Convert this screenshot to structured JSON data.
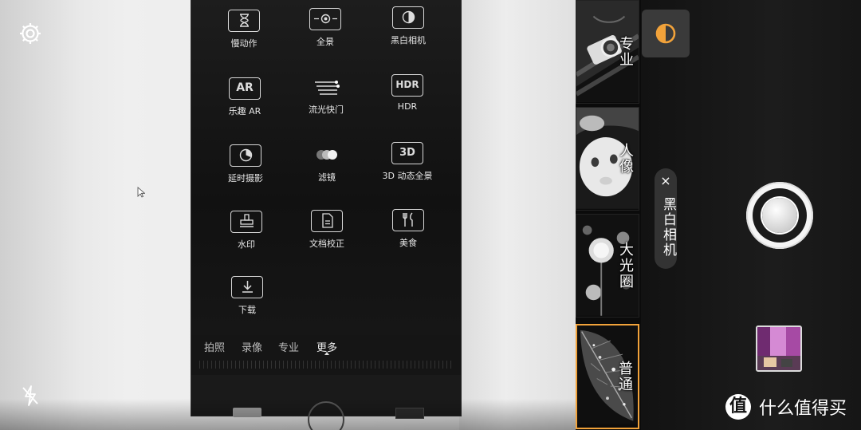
{
  "viewfinder": {
    "photographed_screen": {
      "modes": [
        {
          "label": "慢动作",
          "icon": "hourglass-icon"
        },
        {
          "label": "全景",
          "icon": "panorama-icon"
        },
        {
          "label": "黑白相机",
          "icon": "bw-filter-icon"
        },
        {
          "label": "乐趣 AR",
          "icon": "ar-icon"
        },
        {
          "label": "流光快门",
          "icon": "light-trail-icon"
        },
        {
          "label": "HDR",
          "icon": "hdr-icon"
        },
        {
          "label": "延时摄影",
          "icon": "timelapse-icon"
        },
        {
          "label": "滤镜",
          "icon": "filter-icon"
        },
        {
          "label": "3D 动态全景",
          "icon": "3d-panorama-icon"
        },
        {
          "label": "水印",
          "icon": "stamp-icon"
        },
        {
          "label": "文档校正",
          "icon": "document-icon"
        },
        {
          "label": "美食",
          "icon": "food-icon"
        },
        {
          "label": "下载",
          "icon": "download-icon"
        }
      ],
      "ar_text": "AR",
      "hdr_text": "HDR",
      "three_d_text": "3D",
      "tabs": [
        "拍照",
        "录像",
        "专业",
        "更多"
      ]
    }
  },
  "top_controls": {
    "settings_icon": "gear-icon",
    "flash_icon": "flash-off-icon"
  },
  "mode_strip": {
    "cards": [
      {
        "label": "专业",
        "selected": false
      },
      {
        "label": "人像",
        "selected": false
      },
      {
        "label": "大光圈",
        "selected": false
      },
      {
        "label": "普通",
        "selected": true
      }
    ],
    "selected_color": "#f1a23a"
  },
  "right_panel": {
    "filter_toggle_icon": "half-circle-icon",
    "filter_toggle_color": "#f1a23a",
    "active_filter_chip": {
      "label": "黑白相机",
      "close": "×"
    },
    "shutter_icon": "shutter-icon",
    "gallery_thumbnail_icon": "gallery-thumbnail"
  },
  "watermark": {
    "badge": "值",
    "text": "什么值得买"
  }
}
